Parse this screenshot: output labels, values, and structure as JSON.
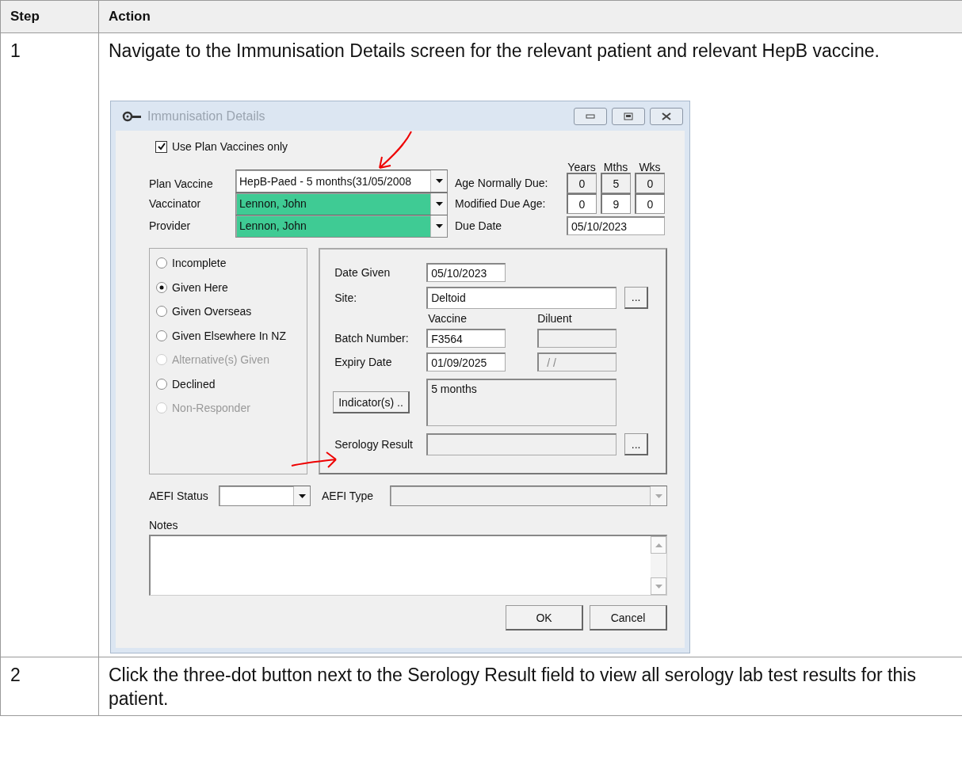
{
  "table": {
    "columns": [
      "Step",
      "Action"
    ],
    "rows": [
      {
        "step": "1",
        "action": "Navigate to the Immunisation Details screen for the relevant patient and relevant HepB vaccine.",
        "screenshot": {
          "title": "Immunisation Details",
          "use_plan_only": {
            "label": "Use Plan Vaccines only",
            "checked": true
          },
          "age_headings": [
            "Years",
            "Mths",
            "Wks"
          ],
          "combos": [
            {
              "label": "Plan Vaccine",
              "value": "HepB-Paed - 5 months(31/05/2008",
              "highlighted": false
            },
            {
              "label": "Vaccinator",
              "value": "Lennon, John",
              "highlighted": true
            },
            {
              "label": "Provider",
              "value": "Lennon, John",
              "highlighted": true
            }
          ],
          "ages": [
            {
              "label": "Age Normally Due:",
              "values": [
                "0",
                "5",
                "0"
              ],
              "disabled": true
            },
            {
              "label": "Modified Due Age:",
              "values": [
                "0",
                "9",
                "0"
              ],
              "disabled": false
            }
          ],
          "due_date": {
            "label": "Due Date",
            "value": "05/10/2023"
          },
          "status_options": [
            {
              "label": "Incomplete",
              "selected": false,
              "disabled": false
            },
            {
              "label": "Given Here",
              "selected": true,
              "disabled": false
            },
            {
              "label": "Given Overseas",
              "selected": false,
              "disabled": false
            },
            {
              "label": "Given Elsewhere In NZ",
              "selected": false,
              "disabled": false
            },
            {
              "label": "Alternative(s) Given",
              "selected": false,
              "disabled": true
            },
            {
              "label": "Declined",
              "selected": false,
              "disabled": false
            },
            {
              "label": "Non-Responder",
              "selected": false,
              "disabled": true
            }
          ],
          "date_given": {
            "label": "Date Given",
            "value": "05/10/2023"
          },
          "site": {
            "label": "Site:",
            "value": "Deltoid",
            "button": "..."
          },
          "batch_headings": [
            "Vaccine",
            "Diluent"
          ],
          "batch_number": {
            "label": "Batch Number:",
            "vaccine": "F3564"
          },
          "expiry_date": {
            "label": "Expiry Date",
            "vaccine": "01/09/2025",
            "diluent": "/ /"
          },
          "indicator": {
            "button": "Indicator(s) ..",
            "value": "5 months"
          },
          "serology_result": {
            "label": "Serology Result",
            "button": "..."
          },
          "aefi_status": {
            "label": "AEFI Status"
          },
          "aefi_type": {
            "label": "AEFI Type",
            "disabled": true
          },
          "notes": {
            "label": "Notes"
          },
          "buttons": [
            "OK",
            "Cancel"
          ]
        }
      },
      {
        "step": "2",
        "action": "Click the three-dot button next to the Serology Result field to view all serology lab test results for this patient."
      }
    ]
  }
}
